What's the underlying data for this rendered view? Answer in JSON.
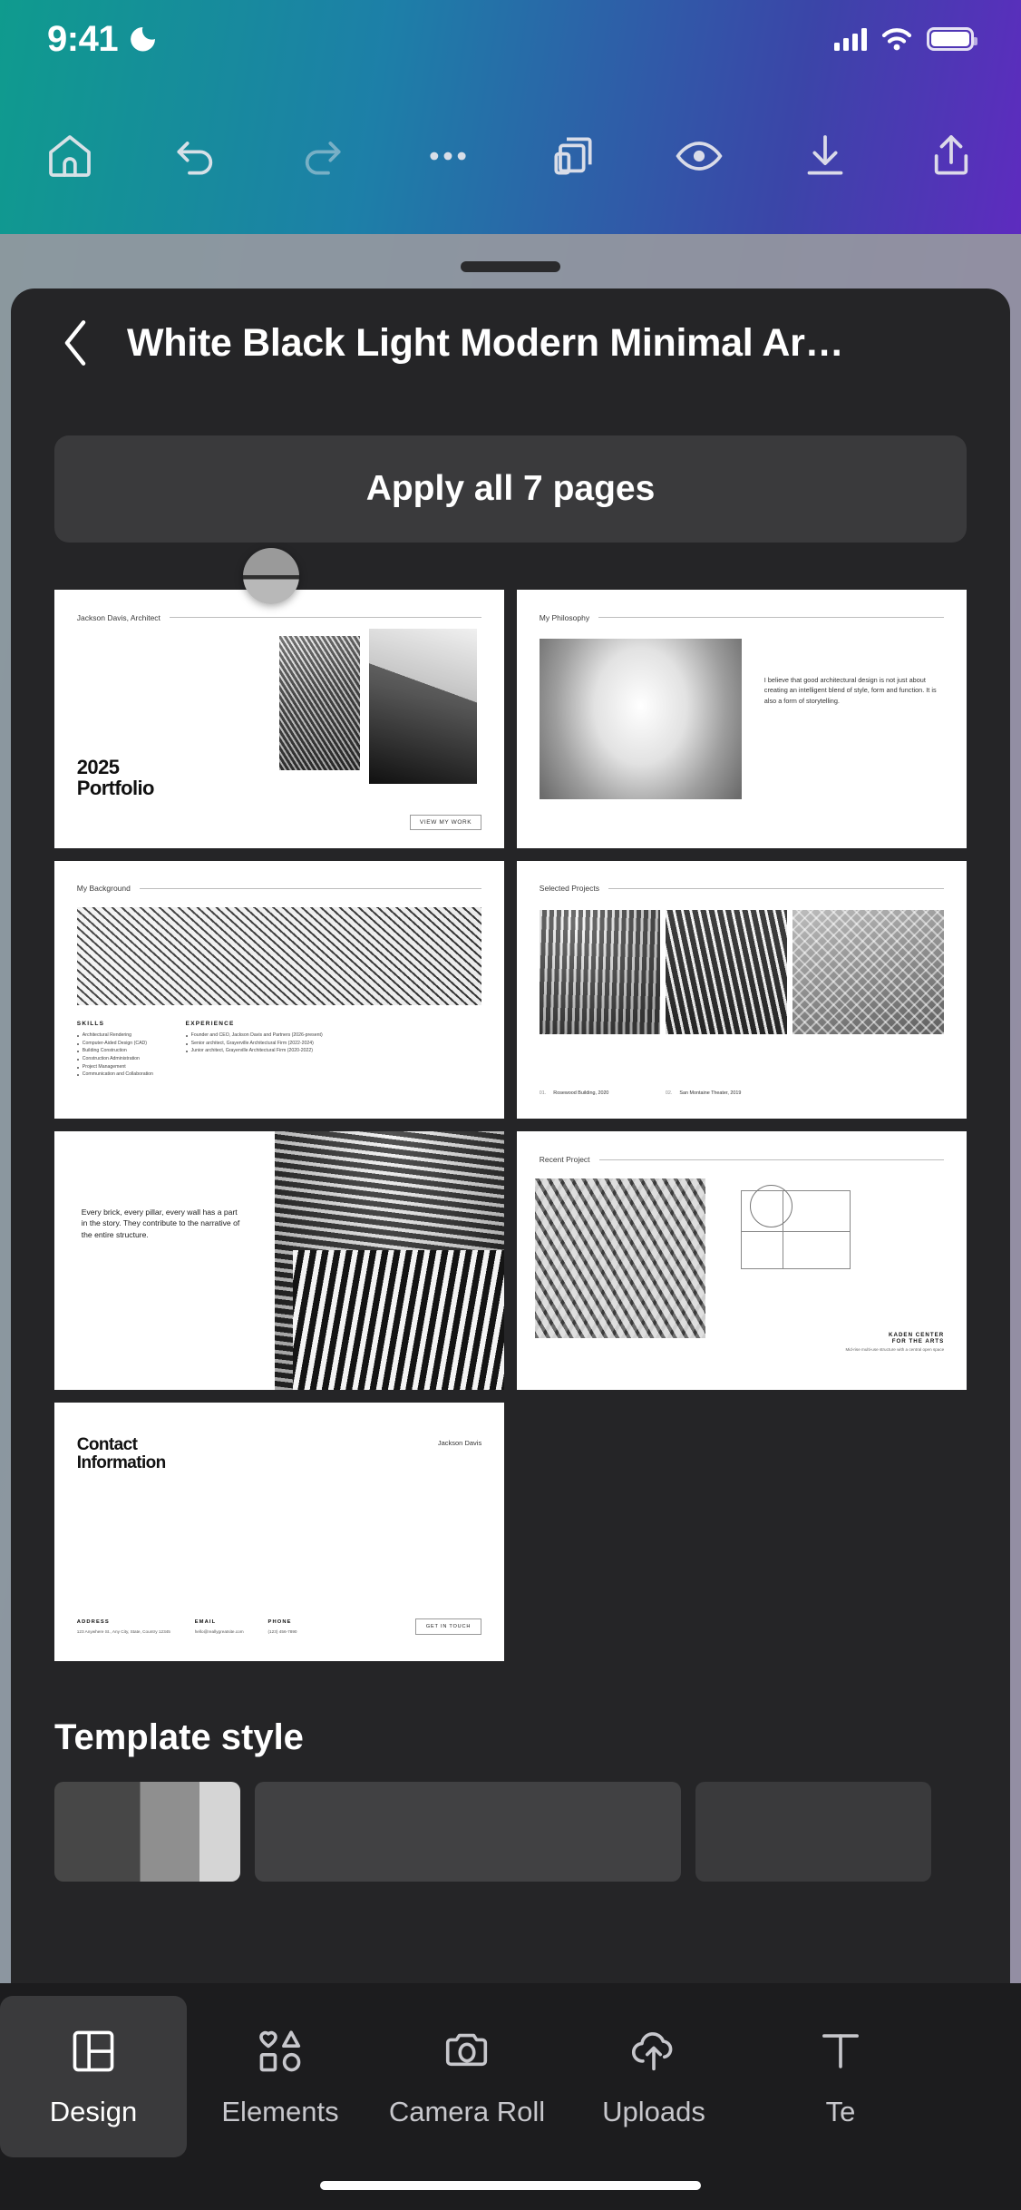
{
  "status_bar": {
    "time": "9:41",
    "dnd_icon": "moon-icon",
    "signal_icon": "cellular-signal-icon",
    "wifi_icon": "wifi-icon",
    "battery_icon": "battery-full-icon"
  },
  "toolbar": {
    "items": [
      {
        "name": "home-button",
        "icon": "home-icon"
      },
      {
        "name": "undo-button",
        "icon": "undo-arrow-icon"
      },
      {
        "name": "redo-button",
        "icon": "redo-arrow-icon"
      },
      {
        "name": "more-options-button",
        "icon": "three-dots-icon"
      },
      {
        "name": "pages-button",
        "icon": "copy-pages-icon"
      },
      {
        "name": "preview-button",
        "icon": "eye-icon"
      },
      {
        "name": "download-button",
        "icon": "download-icon"
      },
      {
        "name": "share-button",
        "icon": "share-up-icon"
      }
    ]
  },
  "sheet": {
    "back_icon": "chevron-left-icon",
    "title": "White Black Light Modern Minimal Ar…",
    "apply_button": "Apply all 7 pages",
    "template_style_heading": "Template style"
  },
  "slides": [
    {
      "n": 1,
      "header": "Jackson Davis, Architect",
      "title_line1": "2025",
      "title_line2": "Portfolio",
      "cta": "VIEW MY WORK"
    },
    {
      "n": 2,
      "header": "My Philosophy",
      "body": "I believe that good architectural design is not just about creating an intelligent blend of style, form and function. It is also a form of storytelling."
    },
    {
      "n": 3,
      "header": "My Background",
      "skills_heading": "SKILLS",
      "skills": [
        "Architectural Rendering",
        "Computer-Aided Design (CAD)",
        "Building Construction",
        "Construction Administration",
        "Project Management",
        "Communication and Collaboration"
      ],
      "experience_heading": "EXPERIENCE",
      "experience": [
        "Founder and CEO, Jackson Davis and Partners (2026-present)",
        "Senior architect, Grayerville Architectural Firm (2022-2024)",
        "Junior architect, Grayerville Architectural Firm (2020-2022)"
      ]
    },
    {
      "n": 4,
      "header": "Selected Projects",
      "projects": [
        {
          "num": "01.",
          "label": "Rosewood Building, 2020"
        },
        {
          "num": "02.",
          "label": "San Montaine Theater, 2019"
        }
      ]
    },
    {
      "n": 5,
      "quote": "Every brick, every pillar, every wall has a part in the story. They contribute to the narrative of the entire structure."
    },
    {
      "n": 6,
      "header": "Recent Project",
      "project_name_line1": "KADEN CENTER",
      "project_name_line2": "FOR THE ARTS",
      "project_desc": "Mid-rise multi-use structure with a central open space"
    },
    {
      "n": 7,
      "title_line1": "Contact",
      "title_line2": "Information",
      "name": "Jackson Davis",
      "fields": [
        {
          "label": "ADDRESS",
          "value": "123 Anywhere St., Any City, State, Country 12345"
        },
        {
          "label": "EMAIL",
          "value": "hello@reallygreatsite.com"
        },
        {
          "label": "PHONE",
          "value": "(123) 456-7890"
        }
      ],
      "button": "GET IN TOUCH"
    }
  ],
  "tab_bar": {
    "items": [
      {
        "label": "Design",
        "icon": "layout-panels-icon",
        "active": true
      },
      {
        "label": "Elements",
        "icon": "shapes-icon",
        "active": false
      },
      {
        "label": "Camera Roll",
        "icon": "camera-icon",
        "active": false
      },
      {
        "label": "Uploads",
        "icon": "cloud-upload-icon",
        "active": false
      },
      {
        "label": "Te",
        "icon": "text-t-icon",
        "active": false
      }
    ]
  },
  "colors": {
    "sheet_bg": "#252527",
    "tab_bar_bg": "#1c1c1e",
    "button_bg": "#3a3a3c",
    "accent_text": "#ffffff"
  }
}
